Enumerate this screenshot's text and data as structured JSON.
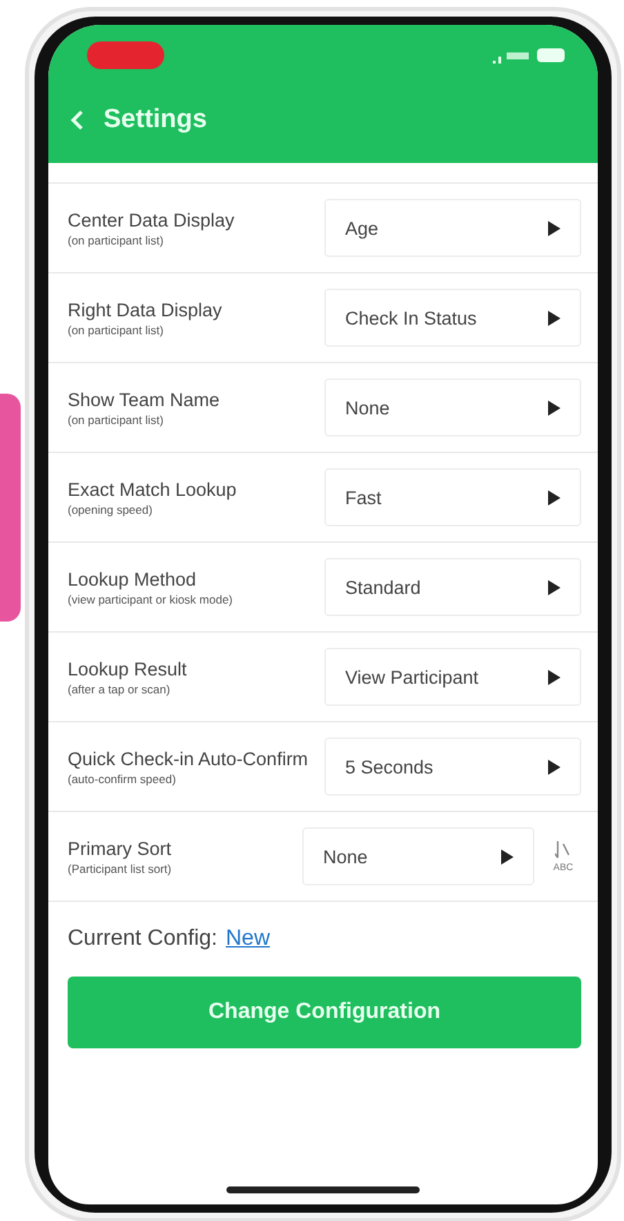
{
  "header": {
    "title": "Settings"
  },
  "settings": [
    {
      "kind": "select",
      "label": "Center Data Display",
      "sub": "(on participant list)",
      "value": "Age"
    },
    {
      "kind": "select",
      "label": "Right Data Display",
      "sub": "(on participant list)",
      "value": "Check In Status"
    },
    {
      "kind": "select",
      "label": "Show Team Name",
      "sub": "(on participant list)",
      "value": "None"
    },
    {
      "kind": "select",
      "label": "Exact Match Lookup",
      "sub": "(opening speed)",
      "value": "Fast"
    },
    {
      "kind": "select",
      "label": "Lookup Method",
      "sub": "(view participant or kiosk mode)",
      "value": "Standard"
    },
    {
      "kind": "select",
      "label": "Lookup Result",
      "sub": "(after a tap or scan)",
      "value": "View Participant"
    },
    {
      "kind": "select",
      "label": "Quick Check-in Auto-Confirm",
      "sub": "(auto-confirm speed)",
      "value": "5 Seconds"
    },
    {
      "kind": "sort",
      "label": "Primary Sort",
      "sub": "(Participant list sort)",
      "value": "None",
      "sort_label": "ABC"
    }
  ],
  "config": {
    "label": "Current Config:",
    "link": "New"
  },
  "button": "Change Configuration"
}
